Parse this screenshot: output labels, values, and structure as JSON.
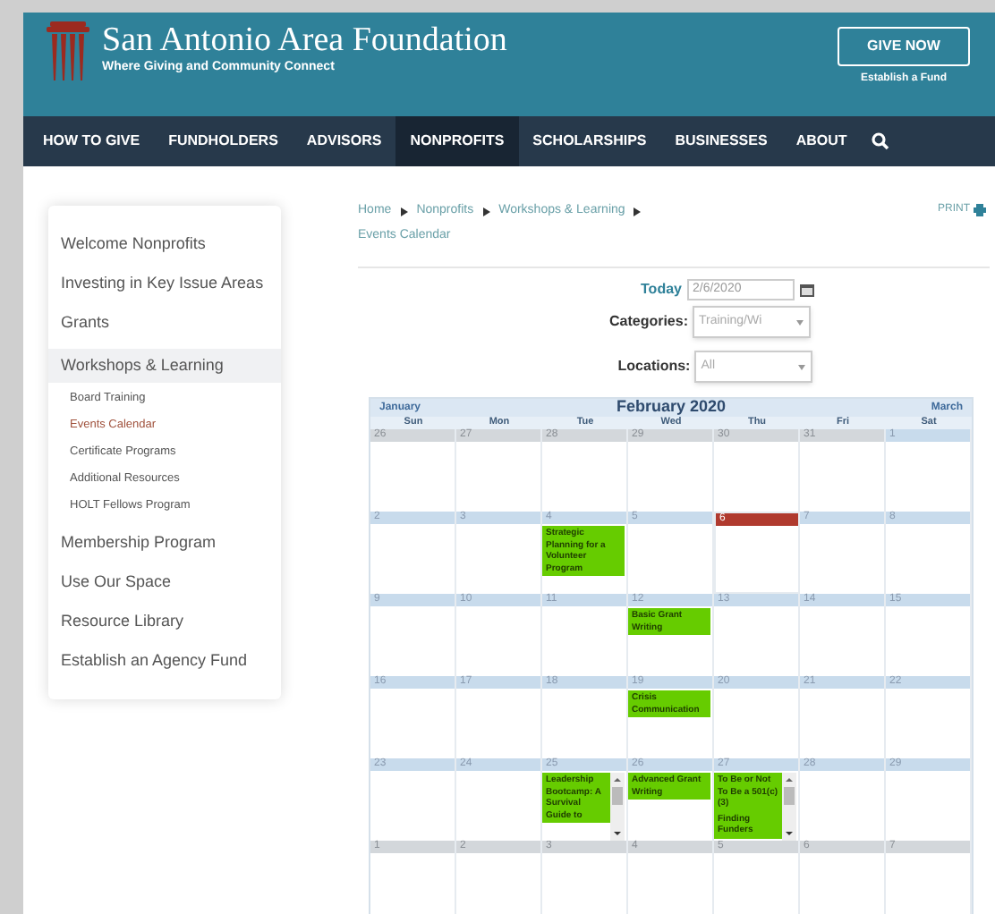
{
  "header": {
    "title": "San Antonio Area Foundation",
    "tagline": "Where Giving and Community Connect",
    "give_button": "GIVE NOW",
    "fund_link": "Establish a Fund"
  },
  "nav": [
    {
      "label": "HOW TO GIVE",
      "selected": false
    },
    {
      "label": "FUNDHOLDERS",
      "selected": false
    },
    {
      "label": "ADVISORS",
      "selected": false
    },
    {
      "label": "NONPROFITS",
      "selected": true
    },
    {
      "label": "SCHOLARSHIPS",
      "selected": false
    },
    {
      "label": "BUSINESSES",
      "selected": false
    },
    {
      "label": "ABOUT",
      "selected": false
    }
  ],
  "sidebar": {
    "items": [
      {
        "label": "Welcome Nonprofits",
        "selected": false
      },
      {
        "label": "Investing in Key Issue Areas",
        "selected": false
      },
      {
        "label": "Grants",
        "selected": false
      },
      {
        "label": "Workshops & Learning",
        "selected": true,
        "children": [
          {
            "label": "Board Training",
            "selected": false
          },
          {
            "label": "Events Calendar",
            "selected": true
          },
          {
            "label": "Certificate Programs",
            "selected": false
          },
          {
            "label": "Additional Resources",
            "selected": false
          },
          {
            "label": "HOLT Fellows Program",
            "selected": false
          }
        ]
      },
      {
        "label": "Membership Program",
        "selected": false
      },
      {
        "label": "Use Our Space",
        "selected": false
      },
      {
        "label": "Resource Library",
        "selected": false
      },
      {
        "label": "Establish an Agency Fund",
        "selected": false
      }
    ]
  },
  "breadcrumb": [
    "Home",
    "Nonprofits",
    "Workshops & Learning",
    "Events Calendar"
  ],
  "print": "PRINT",
  "filters": {
    "today_label": "Today",
    "today_value": "2/6/2020",
    "categories_label": "Categories:",
    "categories_value": "Training/Wi",
    "locations_label": "Locations:",
    "locations_value": "All"
  },
  "calendar": {
    "prev": "January",
    "title": "February 2020",
    "next": "March",
    "weekdays": [
      "Sun",
      "Mon",
      "Tue",
      "Wed",
      "Thu",
      "Fri",
      "Sat"
    ],
    "weeks": [
      [
        {
          "n": "26",
          "muted": true,
          "selected": false
        },
        {
          "n": "27",
          "muted": true,
          "selected": false
        },
        {
          "n": "28",
          "muted": true,
          "selected": false
        },
        {
          "n": "29",
          "muted": true,
          "selected": false
        },
        {
          "n": "30",
          "muted": true,
          "selected": false
        },
        {
          "n": "31",
          "muted": true,
          "selected": false
        },
        {
          "n": "1",
          "muted": false,
          "selected": false
        }
      ],
      [
        {
          "n": "2",
          "muted": false,
          "selected": false
        },
        {
          "n": "3",
          "muted": false,
          "selected": false
        },
        {
          "n": "4",
          "muted": false,
          "selected": false,
          "events": {
            "overflow": false,
            "items": [
              "Strategic Planning for a Volunteer Program"
            ]
          }
        },
        {
          "n": "5",
          "muted": false,
          "selected": false
        },
        {
          "n": "6",
          "muted": false,
          "selected": true
        },
        {
          "n": "7",
          "muted": false,
          "selected": false
        },
        {
          "n": "8",
          "muted": false,
          "selected": false
        }
      ],
      [
        {
          "n": "9",
          "muted": false,
          "selected": false
        },
        {
          "n": "10",
          "muted": false,
          "selected": false
        },
        {
          "n": "11",
          "muted": false,
          "selected": false
        },
        {
          "n": "12",
          "muted": false,
          "selected": false,
          "events": {
            "overflow": false,
            "items": [
              "Basic Grant Writing"
            ]
          }
        },
        {
          "n": "13",
          "muted": false,
          "selected": false
        },
        {
          "n": "14",
          "muted": false,
          "selected": false
        },
        {
          "n": "15",
          "muted": false,
          "selected": false
        }
      ],
      [
        {
          "n": "16",
          "muted": false,
          "selected": false
        },
        {
          "n": "17",
          "muted": false,
          "selected": false
        },
        {
          "n": "18",
          "muted": false,
          "selected": false
        },
        {
          "n": "19",
          "muted": false,
          "selected": false,
          "events": {
            "overflow": false,
            "items": [
              "Crisis Communication"
            ]
          }
        },
        {
          "n": "20",
          "muted": false,
          "selected": false
        },
        {
          "n": "21",
          "muted": false,
          "selected": false
        },
        {
          "n": "22",
          "muted": false,
          "selected": false
        }
      ],
      [
        {
          "n": "23",
          "muted": false,
          "selected": false
        },
        {
          "n": "24",
          "muted": false,
          "selected": false
        },
        {
          "n": "25",
          "muted": false,
          "selected": false,
          "events": {
            "overflow": true,
            "items": [
              "Leadership Bootcamp: A Survival Guide to"
            ]
          }
        },
        {
          "n": "26",
          "muted": false,
          "selected": false,
          "events": {
            "overflow": false,
            "items": [
              "Advanced Grant Writing"
            ]
          }
        },
        {
          "n": "27",
          "muted": false,
          "selected": false,
          "events": {
            "overflow": true,
            "items": [
              "To Be or Not To Be a 501(c)(3)",
              "Finding Funders"
            ]
          }
        },
        {
          "n": "28",
          "muted": false,
          "selected": false
        },
        {
          "n": "29",
          "muted": false,
          "selected": false
        }
      ],
      [
        {
          "n": "1",
          "muted": true,
          "selected": false
        },
        {
          "n": "2",
          "muted": true,
          "selected": false
        },
        {
          "n": "3",
          "muted": true,
          "selected": false
        },
        {
          "n": "4",
          "muted": true,
          "selected": false
        },
        {
          "n": "5",
          "muted": true,
          "selected": false
        },
        {
          "n": "6",
          "muted": true,
          "selected": false
        },
        {
          "n": "7",
          "muted": true,
          "selected": false
        }
      ]
    ]
  }
}
